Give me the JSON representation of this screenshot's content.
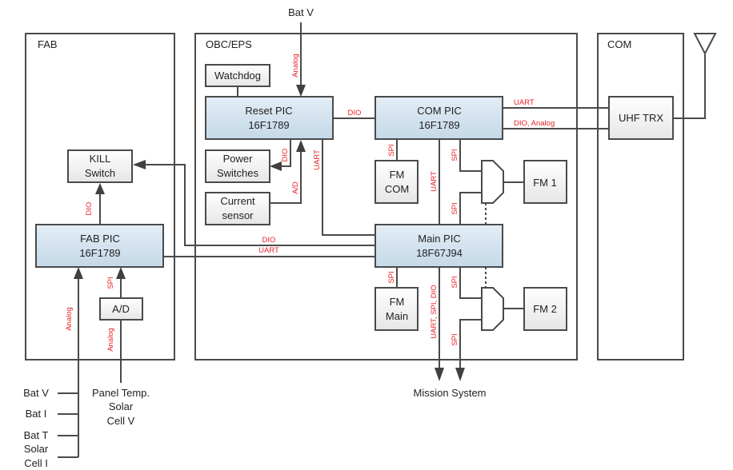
{
  "regions": {
    "fab": "FAB",
    "obc": "OBC/EPS",
    "com": "COM"
  },
  "blocks": {
    "watchdog": [
      "Watchdog"
    ],
    "reset_pic": [
      "Reset PIC",
      "16F1789"
    ],
    "com_pic": [
      "COM PIC",
      "16F1789"
    ],
    "power_switches": [
      "Power",
      "Switches"
    ],
    "current_sensor": [
      "Current",
      "sensor"
    ],
    "fm_com": [
      "FM",
      "COM"
    ],
    "fm1": [
      "FM 1"
    ],
    "main_pic": [
      "Main PIC",
      "18F67J94"
    ],
    "fm_main": [
      "FM",
      "Main"
    ],
    "fm2": [
      "FM 2"
    ],
    "kill_switch": [
      "KILL",
      "Switch"
    ],
    "fab_pic": [
      "FAB PIC",
      "16F1789"
    ],
    "ad": [
      "A/D"
    ],
    "uhf_trx": [
      "UHF TRX"
    ]
  },
  "external": {
    "bat_v_top": "Bat V",
    "mission_system": "Mission System",
    "fab_inputs_left": [
      "Bat V",
      "Bat I",
      "Bat T",
      "Solar",
      "Cell I"
    ],
    "fab_inputs_right": [
      "Panel Temp.",
      "Solar",
      "Cell V"
    ]
  },
  "signals": {
    "batv_analog": "Analog",
    "reset_com_dio": "DIO",
    "com_uhf_uart": "UART",
    "com_uhf_dio_analog": "DIO, Analog",
    "reset_power_dio": "DIO",
    "current_ad": "A/D",
    "reset_main_uart": "UART",
    "com_fmcom_spi": "SPI",
    "com_main_uart": "UART",
    "com_mux1_spi": "SPI",
    "main_mux1_spi": "SPI",
    "kill_dio": "DIO",
    "fab_main_dio": "DIO",
    "fab_main_uart": "UART",
    "main_fmmain_spi": "SPI",
    "main_mission": "UART, SPI, DIO",
    "main_mux2_spi": "SPI",
    "mux2_mission_spi": "SPI",
    "ad_fab_spi": "SPI",
    "fab_analog_in": "Analog",
    "ad_analog_in": "Analog"
  },
  "colors": {
    "pic_fill_top": "#e3edf6",
    "pic_fill_bottom": "#c5d9e8",
    "box_fill_top": "#ffffff",
    "box_fill_bottom": "#e6e6e6",
    "line": "#4a4a4a",
    "signal_label": "#e8222a"
  }
}
